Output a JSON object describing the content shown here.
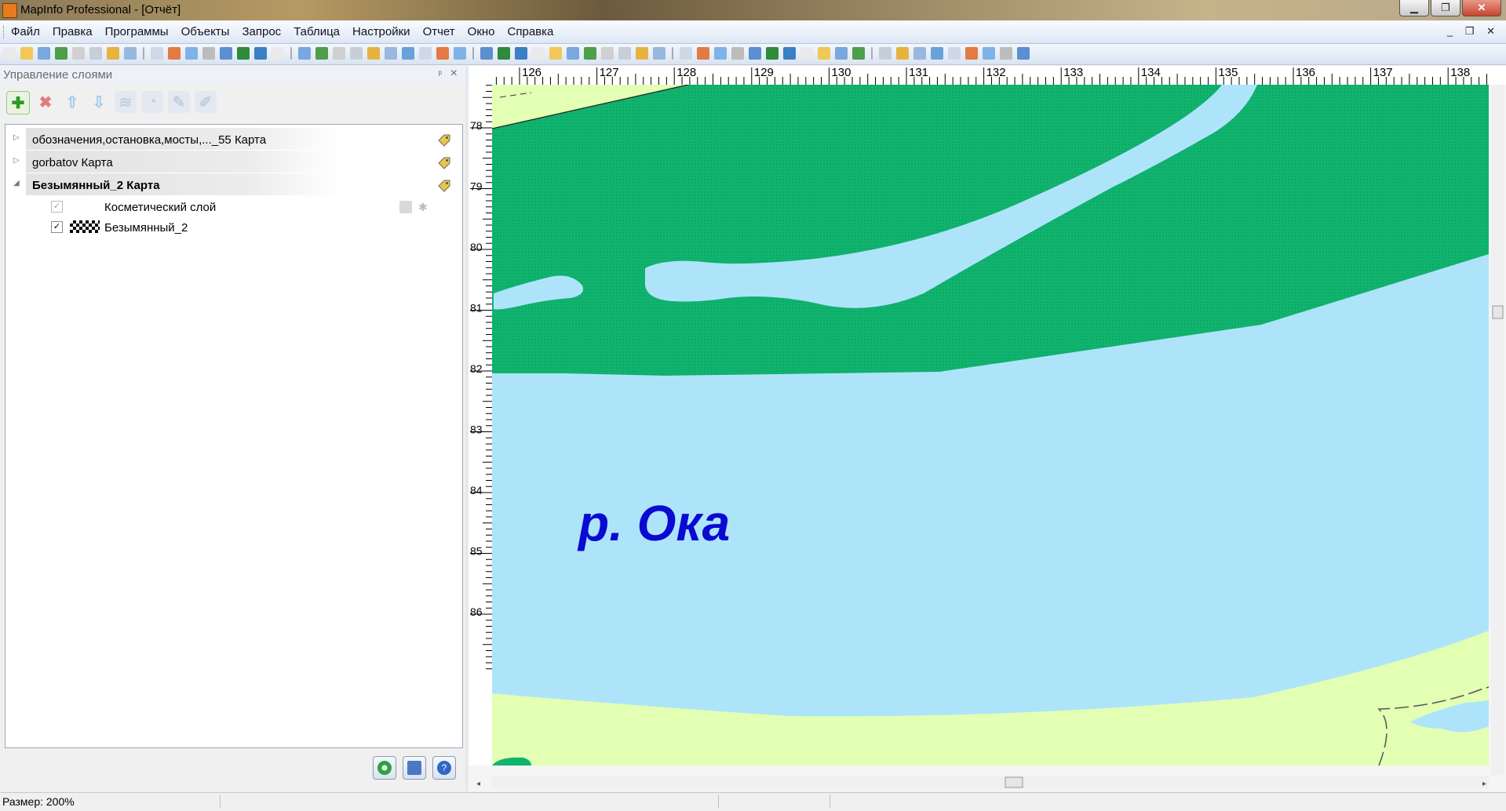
{
  "window": {
    "title": "MapInfo Professional - [Отчёт]"
  },
  "menu": [
    "Файл",
    "Правка",
    "Программы",
    "Объекты",
    "Запрос",
    "Таблица",
    "Настройки",
    "Отчет",
    "Окно",
    "Справка"
  ],
  "layer_panel": {
    "title": "Управление слоями",
    "maps": [
      {
        "name": "обозначения,остановка,мосты,..._55 Карта",
        "expanded": false
      },
      {
        "name": "gorbatov Карта",
        "expanded": false
      },
      {
        "name": "Безымянный_2 Карта",
        "expanded": true
      }
    ],
    "layers": [
      {
        "name": "Косметический слой",
        "checked": true,
        "enabled": false
      },
      {
        "name": "Безымянный_2",
        "checked": true,
        "enabled": true
      }
    ]
  },
  "map": {
    "label": "р. Ока",
    "label_color": "#0a0ad2",
    "water_color": "#aee4fa",
    "forest_color": "#10b46e",
    "land_color": "#e2ffb4",
    "ruler_x": [
      "126",
      "127",
      "128",
      "129",
      "130",
      "131",
      "132",
      "133",
      "134",
      "135",
      "136",
      "137",
      "138"
    ],
    "ruler_y": [
      "78",
      "79",
      "80",
      "81",
      "82",
      "83",
      "84",
      "85",
      "86"
    ]
  },
  "status": {
    "text": "Размер: 200%"
  }
}
